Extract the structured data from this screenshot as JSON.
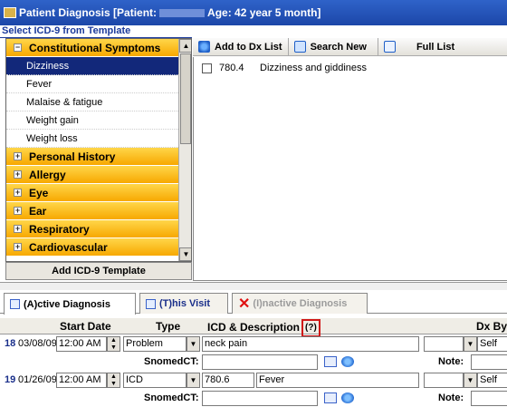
{
  "window": {
    "title_prefix": "Patient Diagnosis  [Patient:",
    "title_suffix": "Age: 42 year 5 month]"
  },
  "template_section": {
    "label": "Select ICD-9 from Template",
    "add_button": "Add ICD-9 Template",
    "categories": [
      {
        "label": "Constitutional Symptoms",
        "expanded": true,
        "items": [
          "Dizziness",
          "Fever",
          "Malaise & fatigue",
          "Weight gain",
          "Weight loss"
        ],
        "selected_item": "Dizziness"
      },
      {
        "label": "Personal History",
        "expanded": false
      },
      {
        "label": "Allergy",
        "expanded": false
      },
      {
        "label": "Eye",
        "expanded": false
      },
      {
        "label": "Ear",
        "expanded": false
      },
      {
        "label": "Respiratory",
        "expanded": false
      },
      {
        "label": "Cardiovascular",
        "expanded": false
      }
    ]
  },
  "toolbar": {
    "add_label": "Add to Dx List",
    "search_label": "Search New",
    "full_label": "Full List"
  },
  "dx_results": [
    {
      "code": "780.4",
      "description": "Dizziness and giddiness",
      "checked": false
    }
  ],
  "tabs": [
    {
      "label": "(A)ctive Diagnosis",
      "active": true
    },
    {
      "label": "(T)his Visit",
      "active": false
    },
    {
      "label": "(I)nactive Diagnosis",
      "active": false,
      "disabled": true
    }
  ],
  "grid": {
    "headers": {
      "start_date": "Start Date",
      "type": "Type",
      "icd_desc": "ICD & Description",
      "help": "(?)",
      "dx_by": "Dx By"
    },
    "snomed_label": "SnomedCT:",
    "note_label": "Note:",
    "rows": [
      {
        "num": "18",
        "date": "03/08/09",
        "time": "12:00 AM",
        "type": "Problem",
        "code": "",
        "description": "neck pain",
        "dx_by": "Self"
      },
      {
        "num": "19",
        "date": "01/26/09",
        "time": "12:00 AM",
        "type": "ICD",
        "code": "780.6",
        "description": "Fever",
        "dx_by": "Self"
      }
    ]
  },
  "colors": {
    "accent": "#1b3a9c",
    "category": "#f7a800",
    "selected": "#12287a",
    "help_highlight": "#d01818"
  }
}
